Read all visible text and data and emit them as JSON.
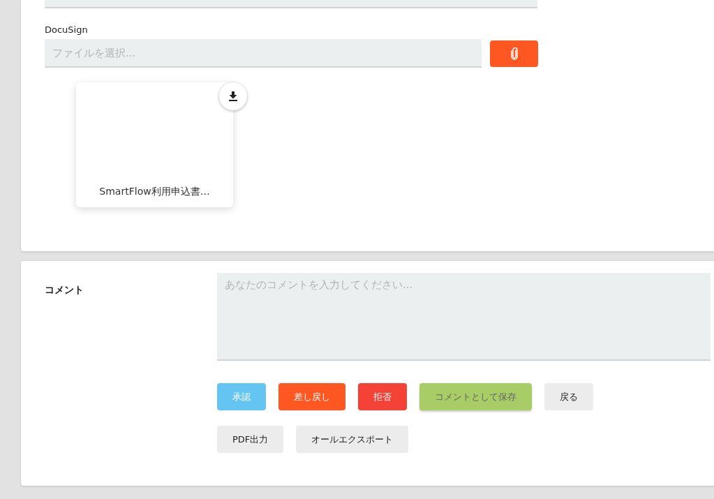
{
  "attachment": {
    "label": "DocuSign",
    "placeholder": "ファイルを選択...",
    "files": [
      {
        "name": "SmartFlow利用申込書…"
      }
    ]
  },
  "comment": {
    "label": "コメント",
    "placeholder": "あなたのコメントを入力してください..."
  },
  "actions": [
    {
      "label": "承認",
      "kind": "approve"
    },
    {
      "label": "差し戻し",
      "kind": "return"
    },
    {
      "label": "拒否",
      "kind": "reject"
    },
    {
      "label": "コメントとして保存",
      "kind": "save"
    },
    {
      "label": "戻る",
      "kind": "plain"
    }
  ],
  "extra_actions": [
    {
      "label": "PDF出力",
      "kind": "plain"
    },
    {
      "label": "オールエクスポート",
      "kind": "plain"
    }
  ]
}
